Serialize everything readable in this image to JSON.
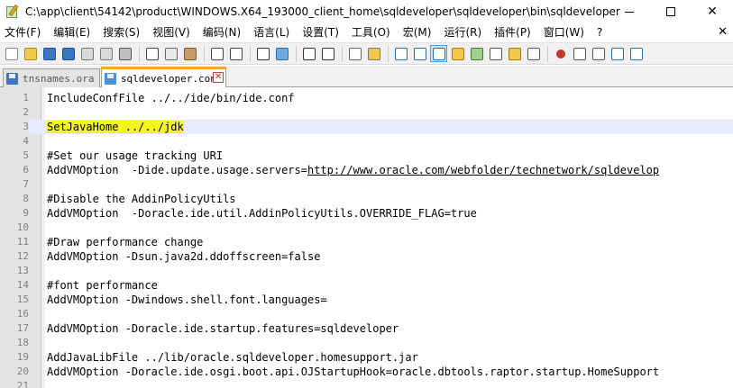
{
  "window": {
    "title": "C:\\app\\client\\54142\\product\\WINDOWS.X64_193000_client_home\\sqldeveloper\\sqldeveloper\\bin\\sqldeveloper...",
    "min_symbol": "—",
    "max_symbol": "☐",
    "close_symbol": "✕"
  },
  "menu": {
    "items": [
      "文件(F)",
      "编辑(E)",
      "搜索(S)",
      "视图(V)",
      "编码(N)",
      "语言(L)",
      "设置(T)",
      "工具(O)",
      "宏(M)",
      "运行(R)",
      "插件(P)",
      "窗口(W)",
      "?"
    ],
    "close_symbol": "✕"
  },
  "tabs": [
    {
      "label": "tnsnames.ora",
      "active": false
    },
    {
      "label": "sqldeveloper.conf",
      "active": true
    }
  ],
  "editor": {
    "lines": [
      {
        "num": "1",
        "pre": "IncludeConfFile ../../ide/bin/ide.conf",
        "url": "",
        "post": ""
      },
      {
        "num": "2",
        "pre": "",
        "url": "",
        "post": ""
      },
      {
        "num": "3",
        "pre": "SetJavaHome ../../jdk",
        "url": "",
        "post": ""
      },
      {
        "num": "4",
        "pre": "",
        "url": "",
        "post": ""
      },
      {
        "num": "5",
        "pre": "#Set our usage tracking URI",
        "url": "",
        "post": ""
      },
      {
        "num": "6",
        "pre": "AddVMOption  -Dide.update.usage.servers=",
        "url": "http://www.oracle.com/webfolder/technetwork/sqldevelop",
        "post": ""
      },
      {
        "num": "7",
        "pre": "",
        "url": "",
        "post": ""
      },
      {
        "num": "8",
        "pre": "#Disable the AddinPolicyUtils",
        "url": "",
        "post": ""
      },
      {
        "num": "9",
        "pre": "AddVMOption  -Doracle.ide.util.AddinPolicyUtils.OVERRIDE_FLAG=true",
        "url": "",
        "post": ""
      },
      {
        "num": "10",
        "pre": "",
        "url": "",
        "post": ""
      },
      {
        "num": "11",
        "pre": "#Draw performance change",
        "url": "",
        "post": ""
      },
      {
        "num": "12",
        "pre": "AddVMOption -Dsun.java2d.ddoffscreen=false",
        "url": "",
        "post": ""
      },
      {
        "num": "13",
        "pre": "",
        "url": "",
        "post": ""
      },
      {
        "num": "14",
        "pre": "#font performance",
        "url": "",
        "post": ""
      },
      {
        "num": "15",
        "pre": "AddVMOption -Dwindows.shell.font.languages=",
        "url": "",
        "post": ""
      },
      {
        "num": "16",
        "pre": "",
        "url": "",
        "post": ""
      },
      {
        "num": "17",
        "pre": "AddVMOption -Doracle.ide.startup.features=sqldeveloper",
        "url": "",
        "post": ""
      },
      {
        "num": "18",
        "pre": "",
        "url": "",
        "post": ""
      },
      {
        "num": "19",
        "pre": "AddJavaLibFile ../lib/oracle.sqldeveloper.homesupport.jar",
        "url": "",
        "post": ""
      },
      {
        "num": "20",
        "pre": "AddVMOption -Doracle.ide.osgi.boot.api.OJStartupHook=oracle.dbtools.raptor.startup.HomeSupport",
        "url": "",
        "post": ""
      },
      {
        "num": "21",
        "pre": "",
        "url": "",
        "post": ""
      }
    ],
    "current_line": "3",
    "highlight_color": "#f5f522",
    "current_line_color": "#e8e8ff"
  },
  "toolbar": {
    "icons": [
      "new-file-icon",
      "open-file-icon",
      "save-icon",
      "save-all-icon",
      "close-icon",
      "close-all-icon",
      "print-icon",
      "sep",
      "cut-icon",
      "copy-icon",
      "paste-icon",
      "sep",
      "undo-icon",
      "redo-icon",
      "sep",
      "find-icon",
      "replace-icon",
      "sep",
      "zoom-in-icon",
      "zoom-out-icon",
      "sep",
      "sync-vertical-icon",
      "sync-horizontal-icon",
      "sep",
      "word-wrap-icon",
      "show-all-chars-icon",
      "indent-guide-icon",
      "user-lang-icon",
      "doc-map-icon",
      "function-list-icon",
      "folder-workspace-icon",
      "monitor-icon",
      "sep",
      "record-macro-icon",
      "stop-record-icon",
      "play-macro-icon",
      "run-macro-multiple-icon",
      "save-macro-icon"
    ],
    "active_icon": "indent-guide-icon"
  }
}
